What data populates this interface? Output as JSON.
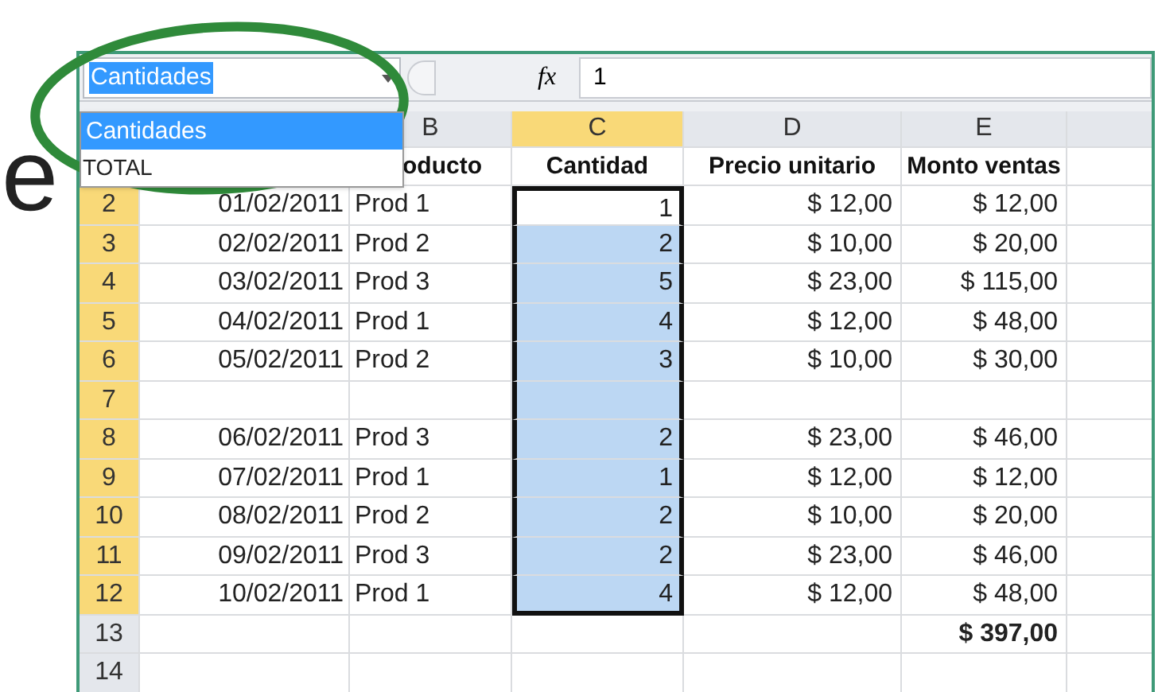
{
  "slide_text": "e",
  "name_box": {
    "value": "Cantidades",
    "expanded": true
  },
  "name_list": [
    {
      "label": "Cantidades",
      "selected": true
    },
    {
      "label": "TOTAL",
      "selected": false
    }
  ],
  "formula_bar": {
    "function_label": "fx",
    "value": "1"
  },
  "columns": [
    {
      "label": "B",
      "selected": false
    },
    {
      "label": "C",
      "selected": true
    },
    {
      "label": "D",
      "selected": false
    },
    {
      "label": "E",
      "selected": false
    }
  ],
  "header_row": [
    "oducto",
    "Cantidad",
    "Precio unitario",
    "Monto ventas"
  ],
  "rows": [
    {
      "number": "2",
      "selected": true,
      "active": true,
      "date": "01/02/2011",
      "product": "Prod 1",
      "quantity": "1",
      "price": "$ 12,00",
      "amount": "$ 12,00"
    },
    {
      "number": "3",
      "selected": true,
      "active": false,
      "date": "02/02/2011",
      "product": "Prod 2",
      "quantity": "2",
      "price": "$ 10,00",
      "amount": "$ 20,00"
    },
    {
      "number": "4",
      "selected": true,
      "active": false,
      "date": "03/02/2011",
      "product": "Prod 3",
      "quantity": "5",
      "price": "$ 23,00",
      "amount": "$ 115,00"
    },
    {
      "number": "5",
      "selected": true,
      "active": false,
      "date": "04/02/2011",
      "product": "Prod 1",
      "quantity": "4",
      "price": "$ 12,00",
      "amount": "$ 48,00"
    },
    {
      "number": "6",
      "selected": true,
      "active": false,
      "date": "05/02/2011",
      "product": "Prod 2",
      "quantity": "3",
      "price": "$ 10,00",
      "amount": "$ 30,00"
    },
    {
      "number": "7",
      "selected": true,
      "active": false
    },
    {
      "number": "8",
      "selected": true,
      "active": false,
      "date": "06/02/2011",
      "product": "Prod 3",
      "quantity": "2",
      "price": "$ 23,00",
      "amount": "$ 46,00"
    },
    {
      "number": "9",
      "selected": true,
      "active": false,
      "date": "07/02/2011",
      "product": "Prod 1",
      "quantity": "1",
      "price": "$ 12,00",
      "amount": "$ 12,00"
    },
    {
      "number": "10",
      "selected": true,
      "active": false,
      "date": "08/02/2011",
      "product": "Prod 2",
      "quantity": "2",
      "price": "$ 10,00",
      "amount": "$ 20,00"
    },
    {
      "number": "11",
      "selected": true,
      "active": false,
      "date": "09/02/2011",
      "product": "Prod 3",
      "quantity": "2",
      "price": "$ 23,00",
      "amount": "$ 46,00"
    },
    {
      "number": "12",
      "selected": true,
      "active": false,
      "date": "10/02/2011",
      "product": "Prod 1",
      "quantity": "4",
      "price": "$ 12,00",
      "amount": "$ 48,00"
    },
    {
      "number": "13",
      "selected": false,
      "active": false,
      "kind": "total",
      "amount": "$ 397,00"
    },
    {
      "number": "14",
      "selected": false,
      "active": false
    }
  ]
}
